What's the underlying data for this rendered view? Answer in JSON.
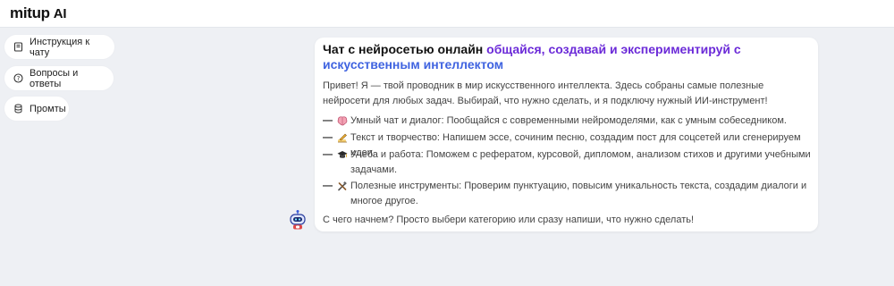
{
  "header": {
    "logo_text": "mitup",
    "logo_suffix": "AI"
  },
  "sidebar": {
    "items": [
      {
        "label": "Инструкция к чату",
        "icon": "book-icon"
      },
      {
        "label": "Вопросы и ответы",
        "icon": "question-circle-icon"
      },
      {
        "label": "Промты",
        "icon": "database-icon"
      }
    ]
  },
  "message": {
    "title_plain": "Чат с нейросетью онлайн ",
    "title_accent_1": "общайся, создавай и экспериментируй с",
    "title_accent_2": "искусственным интеллектом",
    "intro": "Привет! Я — твой проводник в мир искусственного интеллекта. Здесь собраны самые полезные нейросети для любых задач. Выбирай, что нужно сделать, и я подключу нужный ИИ-инструмент!",
    "items": [
      {
        "dash": "—",
        "icon": "brain-icon",
        "text": "Умный чат и диалог: Пообщайся с современными нейромоделями, как с умным собеседником."
      },
      {
        "dash": "—",
        "icon": "writing-hand-icon",
        "text": "Текст и творчество: Напишем эссе, сочиним песню, создадим пост для соцсетей или сгенерируем идеи."
      },
      {
        "dash": "—",
        "icon": "graduation-cap-icon",
        "text": "Учеба и работа: Поможем с рефератом, курсовой, дипломом, анализом стихов и другими учебными задачами."
      },
      {
        "dash": "—",
        "icon": "tools-icon",
        "text": "Полезные инструменты: Проверим пунктуацию, повысим уникальность текста, создадим диалоги и многое другое."
      }
    ],
    "outro": "С чего начнем? Просто выбери категорию или сразу напиши, что нужно сделать!"
  },
  "colors": {
    "accent_purple": "#6b2ad8",
    "accent_blue": "#3f63e0",
    "background": "#eef0f4"
  }
}
